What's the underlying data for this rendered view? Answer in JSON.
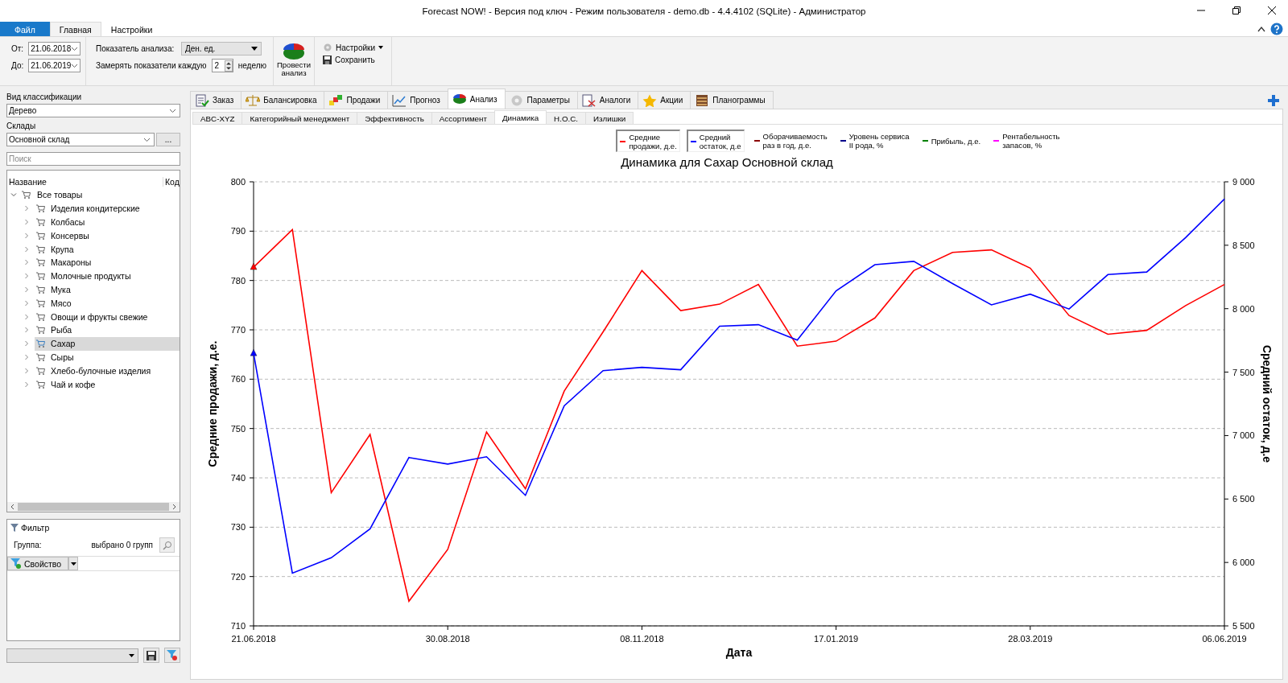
{
  "window": {
    "title": "Forecast NOW! - Версия под ключ - Режим пользователя - demo.db - 4.4.4102 (SQLite) - Администратор"
  },
  "ribbon": {
    "tabs": [
      {
        "label": "Файл",
        "kind": "file",
        "selected": false
      },
      {
        "label": "Главная",
        "kind": "tab",
        "selected": true
      },
      {
        "label": "Настройки",
        "kind": "tab",
        "selected": false
      }
    ],
    "from": {
      "label": "От:",
      "value": "21.06.2018"
    },
    "to": {
      "label": "До:",
      "value": "21.06.2019"
    },
    "indicator": {
      "label": "Показатель анализа:",
      "value": "Ден. ед."
    },
    "measure": {
      "label": "Замерять показатели каждую",
      "value": "2",
      "unit": "неделю"
    },
    "analyze_button": "Провести анализ",
    "settings_menu": "Настройки",
    "save_button": "Сохранить"
  },
  "sidebar": {
    "classification_label": "Вид классификации",
    "classification_value": "Дерево",
    "warehouses_label": "Склады",
    "warehouse_value": "Основной склад",
    "more_button": "...",
    "search": {
      "placeholder": "Поиск"
    },
    "tree_columns": [
      "Название",
      "Код"
    ],
    "tree": [
      {
        "label": "Все товары",
        "expanded": true,
        "selected": false,
        "children": [
          {
            "label": "Изделия кондитерские",
            "expanded": false,
            "selected": false
          },
          {
            "label": "Колбасы",
            "expanded": false,
            "selected": false
          },
          {
            "label": "Консервы",
            "expanded": false,
            "selected": false
          },
          {
            "label": "Крупа",
            "expanded": false,
            "selected": false
          },
          {
            "label": "Макароны",
            "expanded": false,
            "selected": false
          },
          {
            "label": "Молочные продукты",
            "expanded": false,
            "selected": false
          },
          {
            "label": "Мука",
            "expanded": false,
            "selected": false
          },
          {
            "label": "Мясо",
            "expanded": false,
            "selected": false
          },
          {
            "label": "Овощи и фрукты свежие",
            "expanded": false,
            "selected": false
          },
          {
            "label": "Рыба",
            "expanded": false,
            "selected": false
          },
          {
            "label": "Сахар",
            "expanded": false,
            "selected": true
          },
          {
            "label": "Сыры",
            "expanded": false,
            "selected": false
          },
          {
            "label": "Хлебо-булочные изделия",
            "expanded": false,
            "selected": false
          },
          {
            "label": "Чай и кофе",
            "expanded": false,
            "selected": false
          }
        ]
      }
    ],
    "filter": {
      "title": "Фильтр",
      "group_label": "Группа:",
      "group_value": "выбрано 0 групп",
      "property_button": "Свойство"
    }
  },
  "tabs": [
    {
      "label": "Заказ",
      "selected": false
    },
    {
      "label": "Балансировка",
      "selected": false
    },
    {
      "label": "Продажи",
      "selected": false
    },
    {
      "label": "Прогноз",
      "selected": false
    },
    {
      "label": "Анализ",
      "selected": true
    },
    {
      "label": "Параметры",
      "selected": false
    },
    {
      "label": "Аналоги",
      "selected": false
    },
    {
      "label": "Акции",
      "selected": false
    },
    {
      "label": "Планограммы",
      "selected": false
    }
  ],
  "subtabs": [
    {
      "label": "ABC-XYZ",
      "selected": false
    },
    {
      "label": "Категорийный менеджмент",
      "selected": false
    },
    {
      "label": "Эффективность",
      "selected": false
    },
    {
      "label": "Ассортимент",
      "selected": false
    },
    {
      "label": "Динамика",
      "selected": true
    },
    {
      "label": "Н.О.С.",
      "selected": false
    },
    {
      "label": "Излишки",
      "selected": false
    }
  ],
  "legend": [
    {
      "label": "Средние\nпродажи, д.е.",
      "color": "#ff0000",
      "selected": true
    },
    {
      "label": "Средний\nостаток, д.е",
      "color": "#0000ff",
      "selected": true
    },
    {
      "label": "Оборачиваемость\nраз в год, д.е.",
      "color": "#8b0000",
      "selected": false
    },
    {
      "label": "Уровень сервиса\nII рода, %",
      "color": "#00008b",
      "selected": false
    },
    {
      "label": "Прибыль, д.е.",
      "color": "#008000",
      "selected": false
    },
    {
      "label": "Рентабельность\nзапасов, %",
      "color": "#ff00ff",
      "selected": false
    }
  ],
  "chart_data": {
    "type": "line",
    "title": "Динамика для Сахар Основной склад",
    "xlabel": "Дата",
    "ylabel": "Средние продажи, д.е.",
    "y2label": "Средний остаток, д.е",
    "categories": [
      "21.06.2018",
      null,
      null,
      null,
      null,
      "30.08.2018",
      null,
      null,
      null,
      null,
      "08.11.2018",
      null,
      null,
      null,
      null,
      "17.01.2019",
      null,
      null,
      null,
      null,
      "28.03.2019",
      null,
      null,
      null,
      null,
      "06.06.2019"
    ],
    "series": [
      {
        "color": "#ff0000",
        "values": [
          782.7,
          790.3,
          737,
          748.8,
          715,
          725.5,
          749.3,
          737.8,
          757.6,
          769.6,
          782,
          773.9,
          775.2,
          779.2,
          766.7,
          767.7,
          772.4,
          782,
          785.7,
          786.2,
          782.5,
          772.9,
          769.1,
          769.9,
          774.9,
          779.2
        ]
      },
      {
        "color": "#0000ff",
        "axis": "y2",
        "values": [
          7648,
          5915,
          6037,
          6264,
          6827,
          6775,
          6833,
          6529,
          7234,
          7512,
          7538,
          7519,
          7862,
          7874,
          7752,
          8140,
          8347,
          8373,
          8198,
          8030,
          8114,
          7997,
          8269,
          8289,
          8560,
          8864
        ]
      }
    ],
    "grid": true,
    "ylim": [
      710,
      800
    ],
    "yticks": [
      710,
      720,
      730,
      740,
      750,
      760,
      770,
      780,
      790,
      800
    ],
    "y2lim": [
      5500,
      9000
    ],
    "y2ticks": [
      {
        "value": 5500,
        "label": "5 500"
      },
      {
        "value": 6000,
        "label": "6 000"
      },
      {
        "value": 6500,
        "label": "6 500"
      },
      {
        "value": 7000,
        "label": "7 000"
      },
      {
        "value": 7500,
        "label": "7 500"
      },
      {
        "value": 8000,
        "label": "8 000"
      },
      {
        "value": 8500,
        "label": "8 500"
      },
      {
        "value": 9000,
        "label": "9 000"
      }
    ]
  }
}
